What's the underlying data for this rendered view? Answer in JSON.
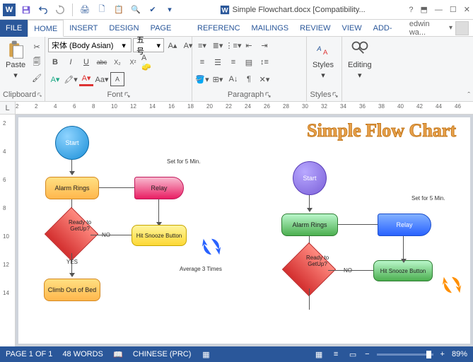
{
  "titlebar": {
    "doc_icon": "W",
    "title": "Simple Flowchart.docx [Compatibility..."
  },
  "tabs": {
    "file": "FILE",
    "home": "HOME",
    "insert": "INSERT",
    "design": "DESIGN",
    "pagelayout": "PAGE LAY",
    "references": "REFERENC",
    "mailings": "MAILINGS",
    "review": "REVIEW",
    "view": "VIEW",
    "addins": "ADD-INS",
    "user": "edwin wa..."
  },
  "ribbon": {
    "clipboard": {
      "paste": "Paste",
      "label": "Clipboard"
    },
    "font": {
      "name": "宋体 (Body Asian)",
      "size": "五号",
      "bold": "B",
      "italic": "I",
      "underline": "U",
      "strike": "abc",
      "sub": "X₂",
      "sup": "X²",
      "label": "Font"
    },
    "paragraph": {
      "label": "Paragraph"
    },
    "styles": {
      "btn": "Styles",
      "label": "Styles"
    },
    "editing": {
      "btn": "Editing"
    }
  },
  "ruler_corner": "L",
  "ruler_h": [
    "2",
    "2",
    "4",
    "6",
    "8",
    "10",
    "12",
    "14",
    "16",
    "18",
    "20",
    "22",
    "24",
    "26",
    "28",
    "30",
    "32",
    "34",
    "36",
    "38",
    "40",
    "42",
    "44",
    "46"
  ],
  "ruler_v": [
    "2",
    "4",
    "6",
    "8",
    "10",
    "12",
    "14"
  ],
  "doc": {
    "title": "Simple Flow Chart",
    "left": {
      "start": "Start",
      "alarm": "Alarm Rings",
      "relay": "Relay",
      "set": "Set for 5 Min.",
      "ready": "Ready to GetUp?",
      "no": "NO",
      "yes": "YES",
      "hit": "Hit Snooze Button",
      "climb": "Climb Out of Bed",
      "avg": "Average 3 Times"
    },
    "right": {
      "start": "Start",
      "alarm": "Alarm Rings",
      "relay": "Relay",
      "set": "Set for 5 Min.",
      "ready": "Ready to GetUp?",
      "no": "NO",
      "hit": "Hit Snooze Button"
    }
  },
  "statusbar": {
    "page": "PAGE 1 OF 1",
    "words": "48 WORDS",
    "lang": "CHINESE (PRC)",
    "zoom": "89%"
  }
}
